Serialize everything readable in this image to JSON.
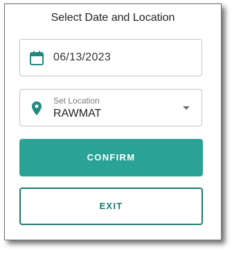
{
  "dialog": {
    "title": "Select Date and Location"
  },
  "date_field": {
    "icon": "calendar-icon",
    "value": "06/13/2023"
  },
  "location_field": {
    "icon": "location-pin-icon",
    "label": "Set Location",
    "value": "RAWMAT"
  },
  "buttons": {
    "confirm_label": "CONFIRM",
    "exit_label": "EXIT"
  },
  "colors": {
    "accent": "#2aa396",
    "accent_dark": "#1a7a70",
    "icon": "#1f8a80"
  }
}
